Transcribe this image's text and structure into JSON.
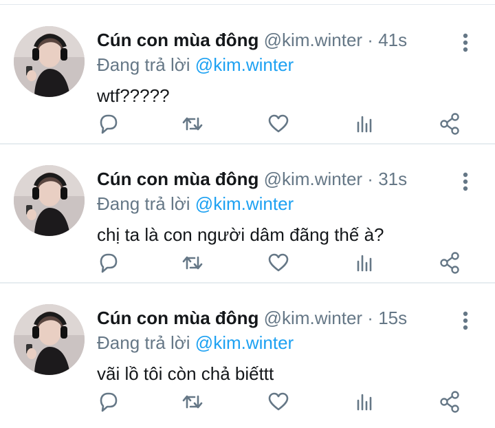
{
  "tweets": [
    {
      "display_name": "Cún con mùa đông",
      "handle": "@kim.winter",
      "separator": "·",
      "time": "41s",
      "replying_prefix": "Đang trả lời",
      "replying_to": "@kim.winter",
      "text": "wtf?????"
    },
    {
      "display_name": "Cún con mùa đông",
      "handle": "@kim.winter",
      "separator": "·",
      "time": "31s",
      "replying_prefix": "Đang trả lời",
      "replying_to": "@kim.winter",
      "text": "chị ta là con người dâm đãng thế à?"
    },
    {
      "display_name": "Cún con mùa đông",
      "handle": "@kim.winter",
      "separator": "·",
      "time": "15s",
      "replying_prefix": "Đang trả lời",
      "replying_to": "@kim.winter",
      "text": "vãi lồ tôi còn chả biếttt"
    }
  ],
  "icons": {
    "reply": "reply-icon",
    "retweet": "retweet-icon",
    "like": "heart-icon",
    "analytics": "analytics-icon",
    "share": "share-icon",
    "more": "more-vertical-icon"
  },
  "colors": {
    "text_primary": "#14171a",
    "text_secondary": "#657786",
    "mention": "#1da1f2",
    "icon": "#657786",
    "divider": "#e6ecf0"
  }
}
